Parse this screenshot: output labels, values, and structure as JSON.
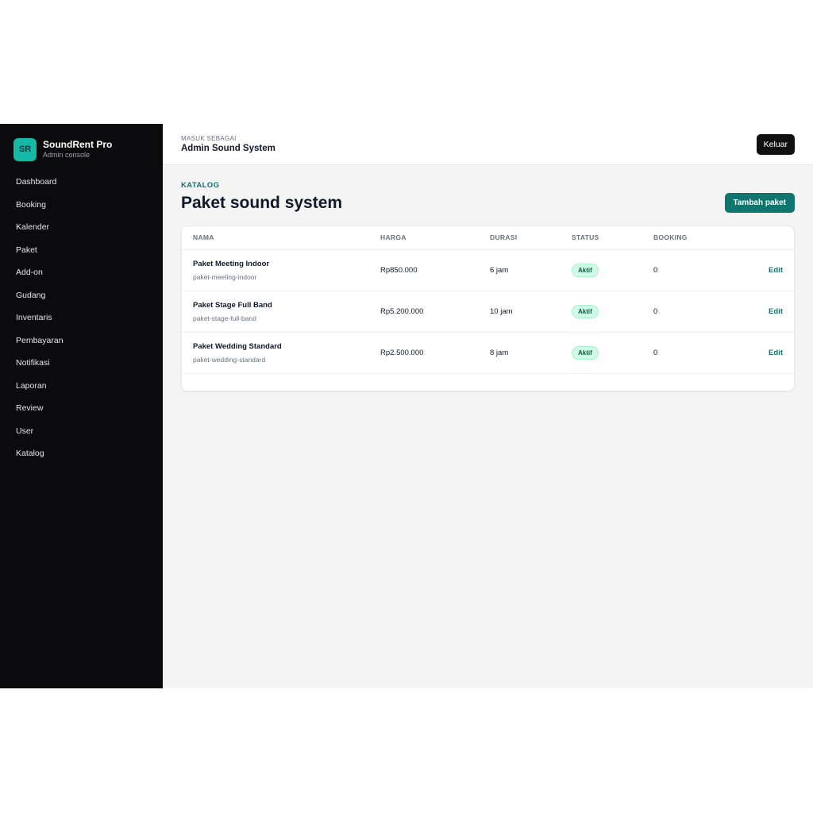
{
  "brand": {
    "logo": "SR",
    "name": "SoundRent Pro",
    "subtitle": "Admin console"
  },
  "sidebar": {
    "items": [
      {
        "label": "Dashboard"
      },
      {
        "label": "Booking"
      },
      {
        "label": "Kalender"
      },
      {
        "label": "Paket"
      },
      {
        "label": "Add-on"
      },
      {
        "label": "Gudang"
      },
      {
        "label": "Inventaris"
      },
      {
        "label": "Pembayaran"
      },
      {
        "label": "Notifikasi"
      },
      {
        "label": "Laporan"
      },
      {
        "label": "Review"
      },
      {
        "label": "User"
      },
      {
        "label": "Katalog"
      }
    ]
  },
  "topbar": {
    "role_label": "MASUK SEBAGAI",
    "role_name": "Admin Sound System",
    "logout_label": "Keluar"
  },
  "page": {
    "eyebrow": "KATALOG",
    "title": "Paket sound system",
    "add_label": "Tambah paket"
  },
  "table": {
    "headers": [
      "NAMA",
      "HARGA",
      "DURASI",
      "STATUS",
      "BOOKING"
    ],
    "rows": [
      {
        "name": "Paket Meeting Indoor",
        "slug": "paket-meeting-indoor",
        "price": "Rp850.000",
        "duration": "6 jam",
        "status": "Aktif",
        "bookings": "0",
        "action": "Edit"
      },
      {
        "name": "Paket Stage Full Band",
        "slug": "paket-stage-full-band",
        "price": "Rp5.200.000",
        "duration": "10 jam",
        "status": "Aktif",
        "bookings": "0",
        "action": "Edit"
      },
      {
        "name": "Paket Wedding Standard",
        "slug": "paket-wedding-standard",
        "price": "Rp2.500.000",
        "duration": "8 jam",
        "status": "Aktif",
        "bookings": "0",
        "action": "Edit"
      }
    ]
  },
  "colors": {
    "accent": "#0f766e",
    "brand_logo": "#14b8a6",
    "sidebar_bg": "#0b0b0d",
    "badge_bg": "#d1fae5"
  }
}
